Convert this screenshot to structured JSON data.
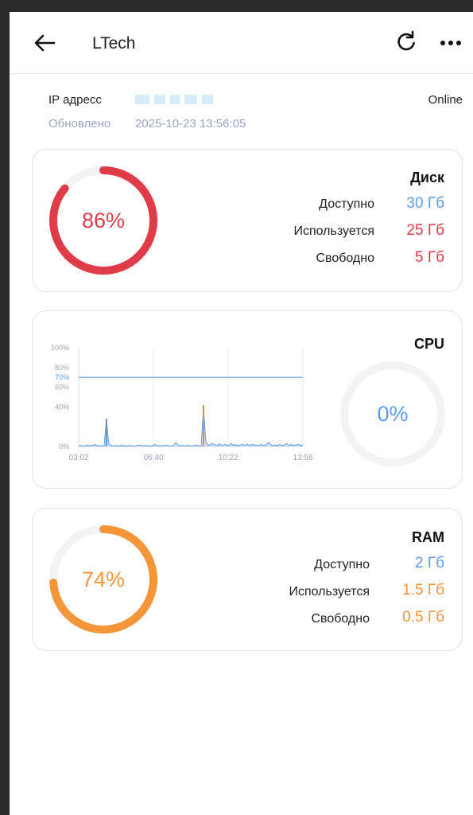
{
  "app": {
    "title": "LTech"
  },
  "icons": {
    "back": "arrow-left-icon",
    "refresh": "refresh-icon",
    "more": "more-horizontal-icon"
  },
  "device": {
    "ip_label": "IP адресс",
    "status": "Online",
    "updated_label": "Обновлено",
    "updated_time": "2025-10-23 13:56:05"
  },
  "colors": {
    "disk": "#e03b48",
    "cpu": "#5b9cf0",
    "ram": "#f5953a",
    "track": "#f2f3f5"
  },
  "disk": {
    "title": "Диск",
    "percent": 86,
    "percent_label": "86%",
    "rows": [
      {
        "label": "Доступно",
        "value": "30 Гб"
      },
      {
        "label": "Используется",
        "value": "25 Гб"
      },
      {
        "label": "Свободно",
        "value": "5 Гб"
      }
    ]
  },
  "cpu": {
    "title": "CPU",
    "percent": 0,
    "percent_label": "0%"
  },
  "ram": {
    "title": "RAM",
    "percent": 74,
    "percent_label": "74%",
    "rows": [
      {
        "label": "Доступно",
        "value": "2 Гб"
      },
      {
        "label": "Используется",
        "value": "1.5 Гб"
      },
      {
        "label": "Свободно",
        "value": "0.5 Гб"
      }
    ]
  },
  "chart_data": {
    "type": "line",
    "title": "",
    "xlabel": "",
    "ylabel": "",
    "ylim": [
      0,
      100
    ],
    "y_ticks": [
      "100%",
      "80%",
      "70%",
      "60%",
      "40%",
      "0%"
    ],
    "y_tick_values": [
      100,
      80,
      70,
      60,
      40,
      0
    ],
    "x_ticks": [
      "03:02",
      "06:40",
      "10:22",
      "13:56"
    ],
    "threshold": 70,
    "grid": true,
    "series": [
      {
        "values": [
          0.5,
          1,
          0.4,
          0.8,
          1.5,
          0.6,
          1,
          2,
          0.8,
          1,
          0.5,
          0.7,
          28,
          3,
          1,
          0.5,
          1,
          0.6,
          0.8,
          1.2,
          0.5,
          0.8,
          1,
          0.6,
          0.4,
          1,
          1.5,
          0.8,
          0.6,
          1,
          0.7,
          0.5,
          1,
          2,
          1,
          0.8,
          0.6,
          0.9,
          1.2,
          0.7,
          0.5,
          1,
          4,
          1.5,
          0.8,
          1,
          0.6,
          0.9,
          1.1,
          0.5,
          0.8,
          1.4,
          0.7,
          0.6,
          40,
          5,
          1,
          2,
          3,
          1.5,
          1,
          2.5,
          1,
          2,
          1.5,
          1,
          3,
          1,
          2,
          1,
          1.5,
          2,
          1,
          2.5,
          1,
          2,
          1.5,
          1,
          1.2,
          2,
          1,
          1.5,
          4,
          2,
          1,
          1.5,
          1,
          2,
          1,
          1.5,
          3,
          1,
          2,
          1,
          1.5,
          2,
          1,
          1.5
        ]
      }
    ],
    "peaks": [
      {
        "x_index": 12,
        "value": 28
      },
      {
        "x_index": 54,
        "value": 42
      }
    ]
  }
}
